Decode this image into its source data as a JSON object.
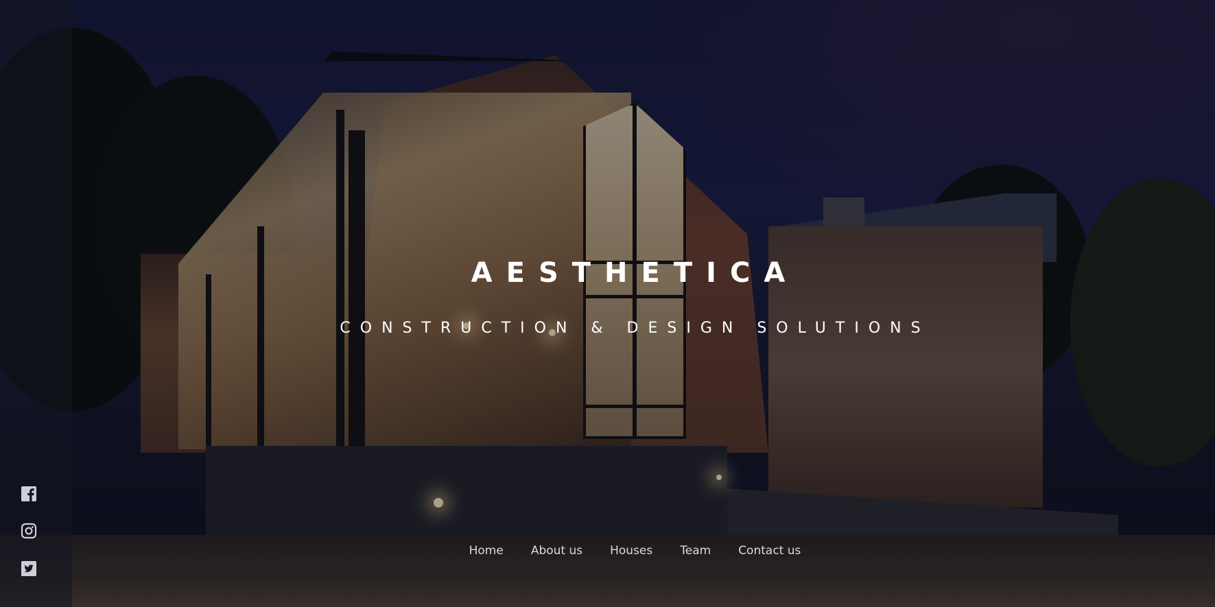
{
  "hero": {
    "title": "AESTHETICA",
    "tagline": "CONSTRUCTION & DESIGN SOLUTIONS"
  },
  "social": [
    {
      "icon": "facebook-icon"
    },
    {
      "icon": "instagram-icon"
    },
    {
      "icon": "twitter-icon"
    }
  ],
  "nav": {
    "items": [
      {
        "label": "Home"
      },
      {
        "label": "About us"
      },
      {
        "label": "Houses"
      },
      {
        "label": "Team"
      },
      {
        "label": "Contact us"
      }
    ]
  },
  "colors": {
    "text": "#ffffff",
    "nav_text": "#d9d9df",
    "sidebar": "#14162a"
  }
}
